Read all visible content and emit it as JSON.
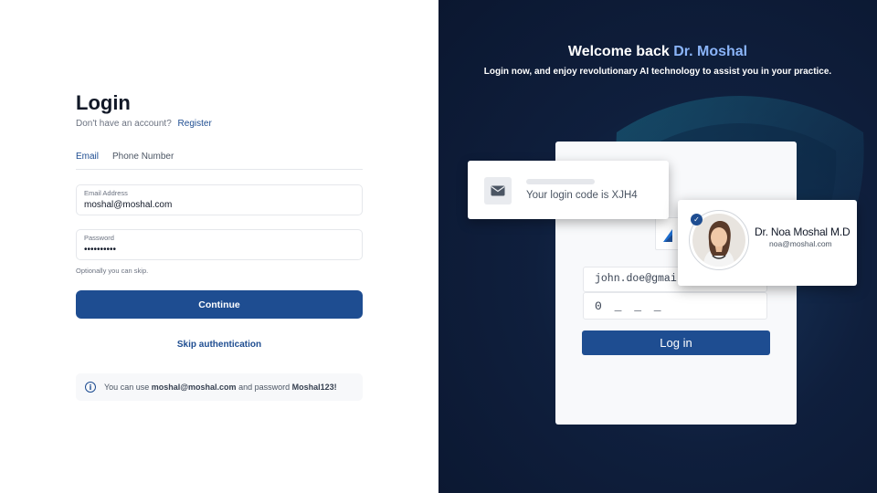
{
  "login": {
    "title": "Login",
    "no_account_text": "Don't have an account?",
    "register_link": "Register",
    "tabs": [
      "Email",
      "Phone Number"
    ],
    "email_field": {
      "label": "Email Address",
      "value": "moshal@moshal.com"
    },
    "password_field": {
      "label": "Password",
      "value": "••••••••••"
    },
    "hint": "Optionally you can skip.",
    "continue_button": "Continue",
    "skip_button": "Skip authentication",
    "info": {
      "prefix": "You can use",
      "email": "moshal@moshal.com",
      "middle": "and password",
      "password": "Moshal123!"
    }
  },
  "promo": {
    "welcome_prefix": "Welcome back",
    "welcome_name": "Dr. Moshal",
    "tagline": "Login now, and enjoy revolutionary AI technology to assist you in your practice.",
    "notification": "Your login code is XJH4",
    "mock_email": "john.doe@gmail",
    "mock_code": "0 _ _ _",
    "mock_login_button": "Log in",
    "profile_name": "Dr. Noa Moshal M.D",
    "profile_email": "noa@moshal.com",
    "colors": {
      "accent": "#1e4d91",
      "panel_bg": "#0f1f3d",
      "name_highlight": "#8ab4f8"
    }
  }
}
